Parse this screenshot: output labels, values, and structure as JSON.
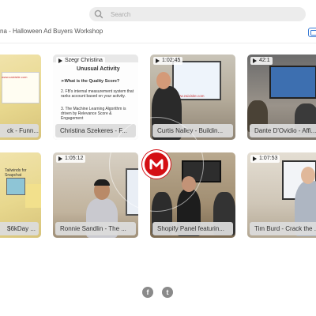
{
  "search": {
    "placeholder": "Search"
  },
  "page_title": "na - Halloween Ad Buyers Workshop",
  "videos_row1": [
    {
      "duration": "",
      "caption": "ck - Funn...",
      "watermark_text": "www.zaixisite.com"
    },
    {
      "duration": "",
      "caption": "Christina Szekeres - F...",
      "tag": "Szegr Christina",
      "slide_title": "Unusual Activity",
      "slide_q": "➢What is the Quality Score?",
      "slide_p1": "2. FB's internal measurement system that ranks account based on your activity.",
      "slide_p2": "3. The Machine Learning Algorithm is driven by Relevance Score & Engagement"
    },
    {
      "duration": "1:02:45",
      "caption": "Curtis Nalley - Buildin...",
      "watermark_text": "www.zaixisite.com"
    },
    {
      "duration": "42:1",
      "caption": "Dante D'Ovidio - Affi..."
    }
  ],
  "videos_row2": [
    {
      "duration": "",
      "caption": "$6kDay ...",
      "slide_text": "Tailwinds for Snapchat"
    },
    {
      "duration": "1:05:12",
      "caption": "Ronnie Sandlin - The ..."
    },
    {
      "duration": "",
      "caption": "Shopify Panel featurin..."
    },
    {
      "duration": "1:07:53",
      "caption": "Tim Burd - Crack the ..."
    }
  ],
  "logo": {
    "letter": "M"
  },
  "social": {
    "facebook": "f",
    "twitter": "t"
  },
  "colors": {
    "logo_red": "#d40f14",
    "accent_blue": "#3a7bd5",
    "search_bg": "#ececec"
  }
}
